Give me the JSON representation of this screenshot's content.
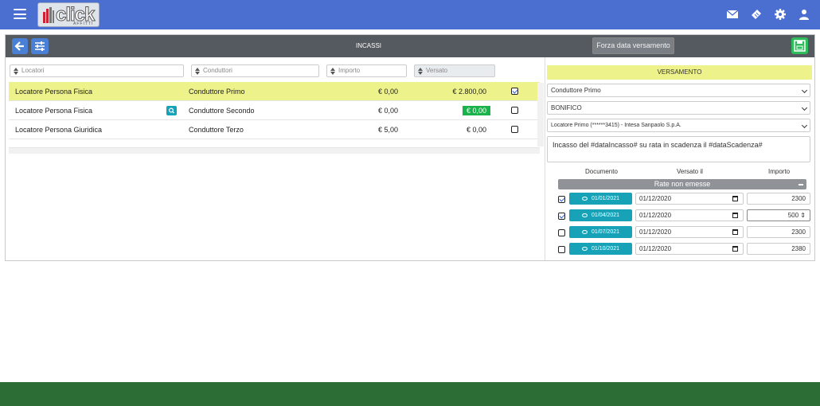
{
  "header": {
    "logo_text": "click",
    "logo_sub": "AFFITTI",
    "icons": [
      "menu-icon",
      "mail-icon",
      "ticket-icon",
      "gear-icon",
      "user-icon"
    ]
  },
  "toolbar": {
    "title": "INCASSI",
    "forza_label": "Forza data versamento"
  },
  "filters": {
    "locatori": "Locatori",
    "conduttori": "Conduttori",
    "importo": "Importo",
    "versato": "Versato"
  },
  "rows": [
    {
      "locatore": "Locatore Persona Fisica",
      "conduttore": "Conduttore Primo",
      "importo": "€ 0,00",
      "versato": "€ 2.800,00",
      "checked": true
    },
    {
      "locatore": "Locatore Persona Fisica",
      "conduttore": "Conduttore Secondo",
      "importo": "€ 0,00",
      "versato": "€ 0,00",
      "checked": false
    },
    {
      "locatore": "Locatore Persona Giuridica",
      "conduttore": "Conduttore Terzo",
      "importo": "€ 5,00",
      "versato": "€ 0,00",
      "checked": false
    }
  ],
  "versamento": {
    "title": "VERSAMENTO",
    "conduttore": "Conduttore Primo",
    "metodo": "BONIFICO",
    "conto": "Locatore Primo (******3415) - Intesa Sanpaolo S.p.A.",
    "descrizione": "Incasso del #dataIncasso# su rata in scadenza il #dataScadenza#",
    "col_documento": "Documento",
    "col_versato": "Versato il",
    "col_importo": "Importo",
    "rate_label": "Rate non emesse",
    "rate": [
      {
        "doc": "01/01/2021",
        "versato": "01/12/2020",
        "importo": "2300",
        "checked": true
      },
      {
        "doc": "01/04/2021",
        "versato": "01/12/2020",
        "importo": "500",
        "checked": true
      },
      {
        "doc": "01/07/2021",
        "versato": "01/12/2020",
        "importo": "2300",
        "checked": false
      },
      {
        "doc": "01/10/2021",
        "versato": "01/12/2020",
        "importo": "2380",
        "checked": false
      }
    ]
  },
  "colors": {
    "topbar": "#4a6fd1",
    "selected_row": "#eef28a",
    "info": "#17a2b8",
    "success": "#19b24b",
    "footer": "#2c6d35"
  }
}
